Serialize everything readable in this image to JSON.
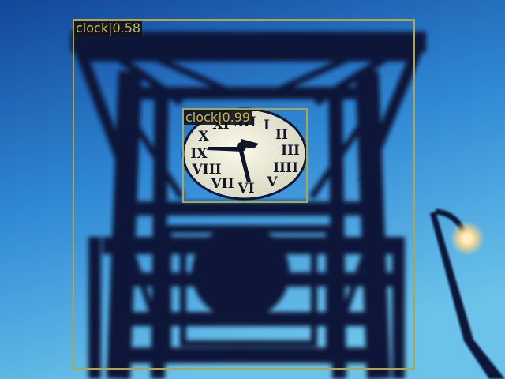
{
  "photo": {
    "subject": "clock tower structure silhouetted against blue sky with street lamp",
    "colors": {
      "sky_top": "#13479a",
      "sky_mid": "#2f88d4",
      "sky_bottom": "#6bc3ea",
      "structure": "#0b1838",
      "clock_face": "#ecebd6",
      "clock_numerals": "#11152a",
      "lamp_glow": "#ffd98a"
    }
  },
  "detections": [
    {
      "label": "clock|0.58",
      "class": "clock",
      "score": 0.58
    },
    {
      "label": "clock|0.99",
      "class": "clock",
      "score": 0.99
    }
  ],
  "box_color": "#b3a544",
  "label_text_color": "#c9b94a"
}
